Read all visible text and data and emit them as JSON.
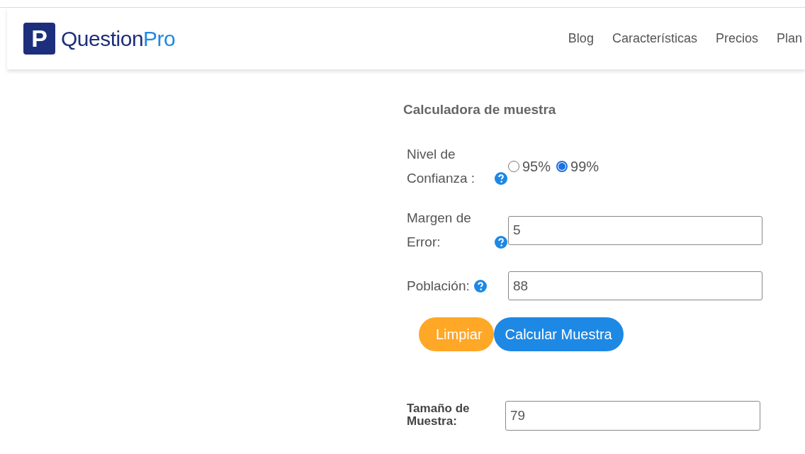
{
  "header": {
    "logo": {
      "mark": "P",
      "name": "Question",
      "name_accent": "Pro"
    },
    "nav": [
      "Blog",
      "Características",
      "Precios",
      "Plan"
    ]
  },
  "calculator": {
    "title": "Calculadora de muestra",
    "confidence": {
      "label": "Nivel de Confianza :",
      "options": [
        {
          "label": "95%",
          "selected": false
        },
        {
          "label": "99%",
          "selected": true
        }
      ]
    },
    "fields": [
      {
        "label": "Margen de Error:",
        "value": "5"
      },
      {
        "label": "Población:",
        "value": "88"
      }
    ],
    "buttons": [
      {
        "label": "Limpiar",
        "kind": "secondary"
      },
      {
        "label": "Calcular Muestra",
        "kind": "primary"
      }
    ],
    "result": {
      "label": "Tamaño de Muestra:",
      "value": "79"
    }
  }
}
